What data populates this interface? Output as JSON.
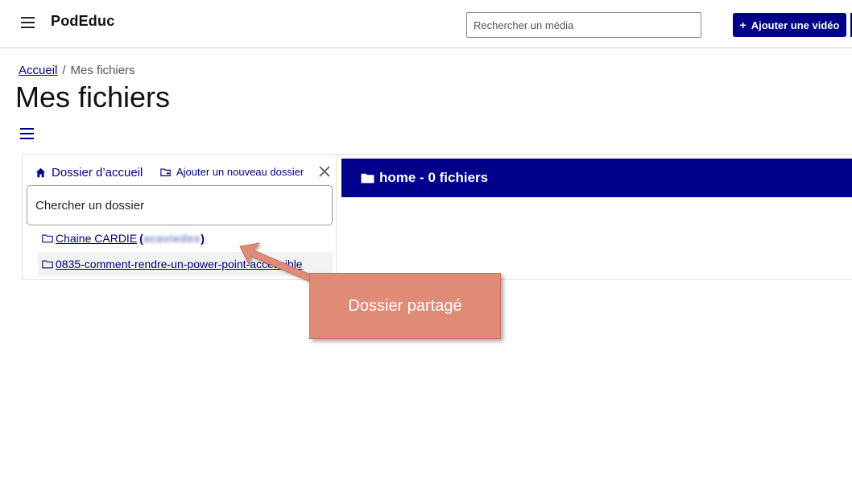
{
  "header": {
    "brand": "PodEduc",
    "search_placeholder": "Rechercher un média",
    "add_video_label": "Ajouter une vidéo",
    "add_video_icon": "plus-icon"
  },
  "breadcrumb": {
    "home": "Accueil",
    "separator": "/",
    "current": "Mes fichiers"
  },
  "page": {
    "title": "Mes fichiers"
  },
  "sidebar": {
    "home_label": "Dossier d’accueil",
    "new_folder_label": "Ajouter un nouveau dossier",
    "search_placeholder": "Chercher un dossier",
    "folders": [
      {
        "name": "Chaine CARDIE",
        "owner": "acaviedes",
        "icon": "folder-icon"
      },
      {
        "name": "0835-comment-rendre-un-power-point-accessible",
        "icon": "folder-icon"
      }
    ]
  },
  "main": {
    "folder_header": "home - 0 fichiers"
  },
  "annotation": {
    "label": "Dossier partagé"
  },
  "colors": {
    "accent": "#00008b",
    "callout": "#e08a78"
  }
}
